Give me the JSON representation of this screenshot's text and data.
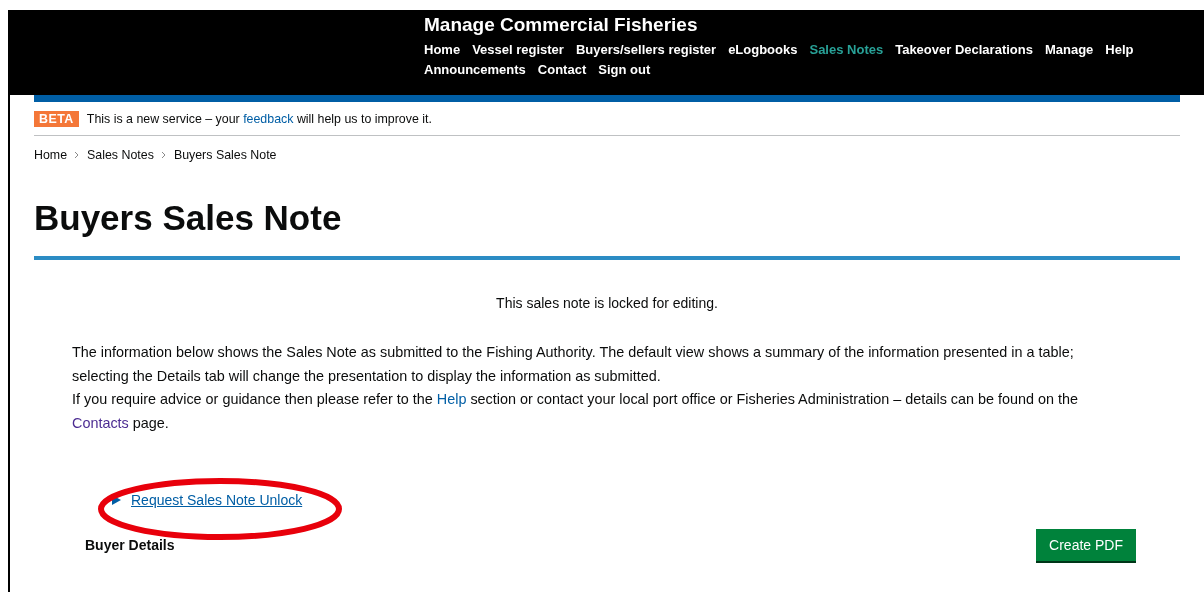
{
  "header": {
    "title": "Manage Commercial Fisheries",
    "nav": [
      {
        "label": "Home",
        "selected": false
      },
      {
        "label": "Vessel register",
        "selected": false
      },
      {
        "label": "Buyers/sellers register",
        "selected": false
      },
      {
        "label": "eLogbooks",
        "selected": false
      },
      {
        "label": "Sales Notes",
        "selected": true
      },
      {
        "label": "Takeover Declarations",
        "selected": false
      },
      {
        "label": "Manage",
        "selected": false
      },
      {
        "label": "Help",
        "selected": false
      },
      {
        "label": "Announcements",
        "selected": false
      },
      {
        "label": "Contact",
        "selected": false
      },
      {
        "label": "Sign out",
        "selected": false
      }
    ]
  },
  "beta": {
    "tag": "BETA",
    "parts": [
      {
        "kind": "text",
        "text": "This is a new service – your"
      },
      {
        "kind": "link",
        "text": "feedback"
      },
      {
        "kind": "text",
        "text": "will help us to improve it."
      }
    ]
  },
  "breadcrumbs": [
    "Home",
    "Sales Notes",
    "Buyers Sales Note"
  ],
  "page_title": "Buyers Sales Note",
  "locked_notice": "This sales note is locked for editing.",
  "intro": [
    {
      "parts": [
        {
          "kind": "text",
          "text": "The information below shows the Sales Note as submitted to the Fishing Authority. The default view shows a summary of the information presented in a table; selecting the Details tab will change the presentation to display the information as submitted."
        }
      ]
    },
    {
      "parts": [
        {
          "kind": "text",
          "text": "If you require advice or guidance then please refer to the"
        },
        {
          "kind": "link",
          "text": "Help"
        },
        {
          "kind": "text",
          "text": "section or contact your local port office or Fisheries Administration – details can be found on the"
        },
        {
          "kind": "link",
          "text": "Contacts"
        },
        {
          "kind": "text",
          "text": "page."
        }
      ]
    }
  ],
  "unlock_link": "Request Sales Note Unlock",
  "buyer_details": {
    "heading": "Buyer Details",
    "pdf_button": "Create PDF"
  }
}
